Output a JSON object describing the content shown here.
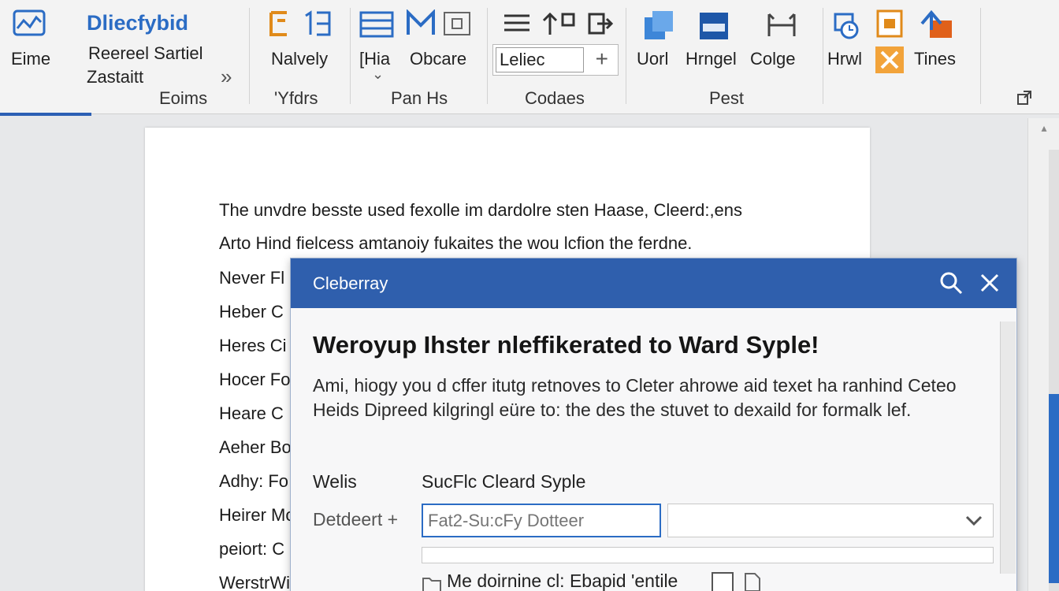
{
  "ribbon": {
    "home_tab": "Eime",
    "blue_title": "Dliecfybid",
    "items": {
      "reresel": "Reereel Sartiel",
      "zastatt": "Zastaitt",
      "group_styles": "Eoims",
      "nalvely": "Nalvely",
      "group_yfdrs": "'Yfdrs",
      "hia": "[Hia",
      "obcare": "Obcare",
      "group_panhs": "Pan Hs",
      "combo_value": "Leliec",
      "group_codaes": "Codaes",
      "uorl": "Uorl",
      "hngel": "Hrngel",
      "colge": "Colge",
      "group_pest": "Pest",
      "hrwl": "Hrwl",
      "tines": "Tines"
    }
  },
  "document": {
    "lines": [
      "The unvdre besste used fexolle im dardolre sten Haase, Cleerd:,ens",
      "Arto Hind fielcess amtanoiy fukaites the wou lcfion the ferdne.",
      "Never Fl",
      "Heber C",
      "Heres Ci",
      "Hocer Fo",
      "Heare C",
      "Aeher Bo",
      "Adhy: Fo",
      "Heirer Mo",
      "peiort: C",
      "WerstrWi"
    ]
  },
  "dialog": {
    "title": "Cleberray",
    "heading": "Weroyup Ihster nleffikerated to Ward Syple!",
    "body": "Ami, hiogy you d cffer itutg retnoves to Cleter ahrowe aid texet ha ranhind Ceteo Heids Dipreed kilgringl eüre to: the des the stuvet to dexaild for formalk lef.",
    "row1_label": "Welis",
    "row1_value": "SucFlc Cleard Syple",
    "row2_label": "Detdeert +",
    "input_placeholder": "Fat2-Su:cFy Dotteer",
    "checkbox_label": "Me doirnine cl: Ebapid 'entile"
  }
}
